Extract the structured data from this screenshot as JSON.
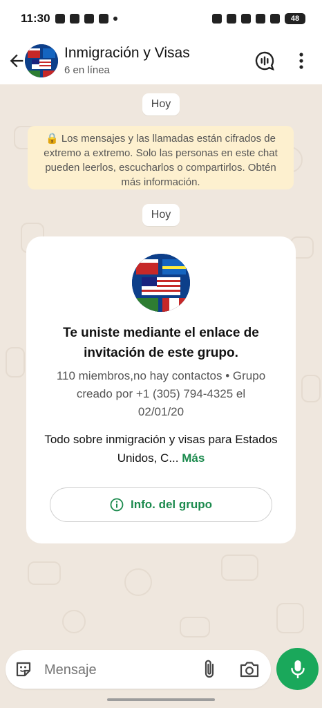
{
  "status_bar": {
    "time": "11:30",
    "battery": "48"
  },
  "header": {
    "title": "Inmigración y Visas",
    "subtitle": "6 en línea"
  },
  "chat": {
    "date_chips": [
      "Hoy",
      "Hoy"
    ],
    "encryption_notice": "🔒 Los mensajes y las llamadas están cifrados de extremo a extremo. Solo las personas en este chat pueden leerlos, escucharlos o compartirlos. Obtén más información.",
    "group_card": {
      "title": "Te uniste mediante el enlace de invitación de este grupo.",
      "meta": "110 miembros,no hay contactos • Grupo creado por +1 (305) 794-4325 el 02/01/20",
      "description": "Todo sobre inmigración y visas para Estados Unidos, C...",
      "more_label": "Más",
      "info_button_label": "Info. del grupo"
    }
  },
  "composer": {
    "placeholder": "Mensaje"
  },
  "colors": {
    "accent": "#1aa85b",
    "link": "#1b8a4d",
    "chat_bg": "#efe7de",
    "notice_bg": "#fdf0cf"
  },
  "icons": [
    "back-arrow-icon",
    "voice-chat-icon",
    "more-vert-icon",
    "sticker-icon",
    "attach-icon",
    "camera-icon",
    "mic-icon",
    "info-icon"
  ]
}
